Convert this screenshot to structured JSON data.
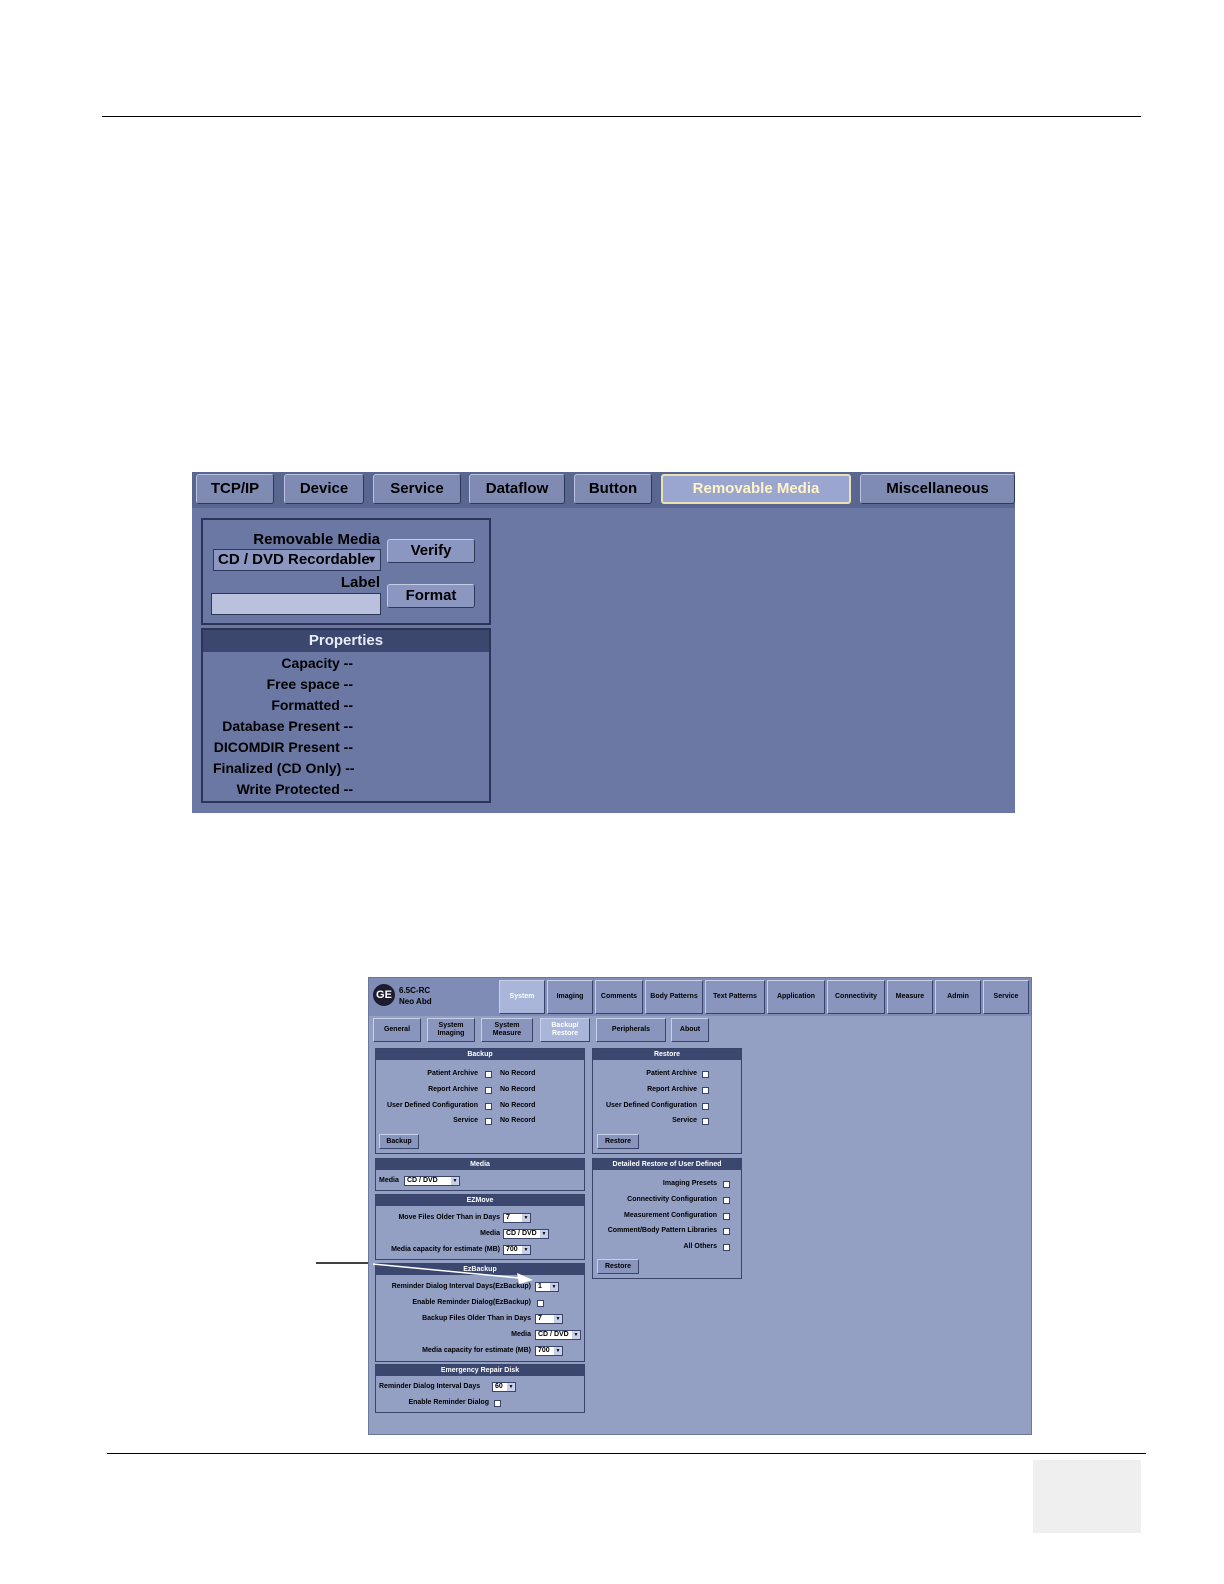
{
  "screen1": {
    "tabs": [
      "TCP/IP",
      "Device",
      "Service",
      "Dataflow",
      "Button",
      "Removable Media",
      "Miscellaneous"
    ],
    "removable_media_label": "Removable Media",
    "media_select_value": "CD / DVD Recordable",
    "label_label": "Label",
    "label_value": "",
    "verify_button": "Verify",
    "format_button": "Format",
    "properties_title": "Properties",
    "properties": [
      {
        "label": "Capacity",
        "value": "--"
      },
      {
        "label": "Free space",
        "value": "--"
      },
      {
        "label": "Formatted",
        "value": "--"
      },
      {
        "label": "Database Present",
        "value": "--"
      },
      {
        "label": "DICOMDIR Present",
        "value": "--"
      },
      {
        "label": "Finalized (CD Only)",
        "value": "--"
      },
      {
        "label": "Write Protected",
        "value": "--"
      }
    ]
  },
  "screen2": {
    "version": "6.5C-RC",
    "preset": "Neo Abd",
    "main_tabs": [
      "System",
      "Imaging",
      "Comments",
      "Body Patterns",
      "Text Patterns",
      "Application",
      "Connectivity",
      "Measure",
      "Admin",
      "Service"
    ],
    "sub_tabs": [
      "General",
      "System Imaging",
      "System Measure",
      "Backup/ Restore",
      "Peripherals",
      "About"
    ],
    "backup": {
      "title": "Backup",
      "rows": [
        {
          "label": "Patient Archive",
          "status": "No Record"
        },
        {
          "label": "Report Archive",
          "status": "No Record"
        },
        {
          "label": "User Defined Configuration",
          "status": "No Record"
        },
        {
          "label": "Service",
          "status": "No Record"
        }
      ],
      "button": "Backup"
    },
    "restore": {
      "title": "Restore",
      "rows": [
        "Patient Archive",
        "Report Archive",
        "User Defined Configuration",
        "Service"
      ],
      "button": "Restore"
    },
    "media": {
      "title": "Media",
      "label": "Media",
      "value": "CD / DVD"
    },
    "ezmove": {
      "title": "EZMove",
      "older_label": "Move Files Older Than in Days",
      "older_value": "7",
      "media_label": "Media",
      "media_value": "CD / DVD",
      "capacity_label": "Media capacity for estimate (MB)",
      "capacity_value": "700"
    },
    "ezbackup": {
      "title": "EzBackup",
      "interval_label": "Reminder Dialog Interval Days(EzBackup)",
      "interval_value": "1",
      "enable_label": "Enable Reminder Dialog(EzBackup)",
      "older_label": "Backup Files Older Than in Days",
      "older_value": "7",
      "media_label": "Media",
      "media_value": "CD / DVD",
      "capacity_label": "Media capacity for estimate (MB)",
      "capacity_value": "700"
    },
    "erd": {
      "title": "Emergency Repair Disk",
      "interval_label": "Reminder Dialog Interval Days",
      "interval_value": "60",
      "enable_label": "Enable Reminder Dialog"
    },
    "detailed": {
      "title": "Detailed Restore of User Defined",
      "rows": [
        "Imaging Presets",
        "Connectivity Configuration",
        "Measurement Configuration",
        "Comment/Body Pattern Libraries",
        "All Others"
      ],
      "button": "Restore"
    }
  }
}
